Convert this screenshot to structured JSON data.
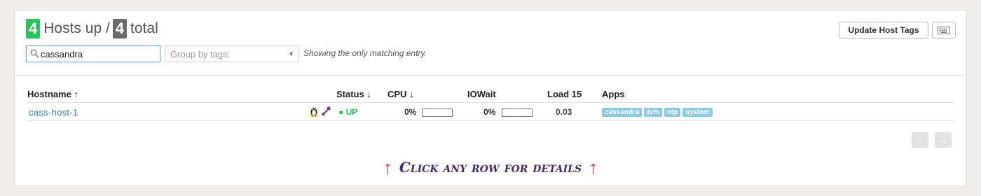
{
  "summary": {
    "up_count": "4",
    "up_label": "Hosts up /",
    "total_count": "4",
    "total_label": "total",
    "up_color": "#2bc35b",
    "total_color": "#6b6b6b"
  },
  "filters": {
    "search_value": "cassandra",
    "group_placeholder": "Group by tags:",
    "match_text": "Showing the only matching entry."
  },
  "toolbar": {
    "update_tags_label": "Update Host Tags",
    "keyboard_icon": "keyboard-icon"
  },
  "table": {
    "columns": {
      "hostname": "Hostname ↑",
      "status": "Status ↓",
      "cpu": "CPU ↓",
      "iowait": "IOWait",
      "load15": "Load 15",
      "apps": "Apps"
    },
    "rows": [
      {
        "hostname": "cass-host-1",
        "os_icon": "linux-penguin-icon",
        "agent_icon": "puppet-icon",
        "status": "● UP",
        "cpu": "0%",
        "cpu_fraction": 0,
        "iowait": "0%",
        "iowait_fraction": 0,
        "load15": "0.03",
        "apps": [
          "cassandra",
          "jvm",
          "ntp",
          "system"
        ]
      }
    ]
  },
  "pager": {
    "prev_icon": "arrow-left-icon",
    "next_icon": "arrow-right-icon",
    "prev_label": "←",
    "next_label": "→"
  },
  "hint": {
    "text": "Click any row for details",
    "arrow_color": "#e0198a",
    "text_color": "#4a2a6b"
  }
}
